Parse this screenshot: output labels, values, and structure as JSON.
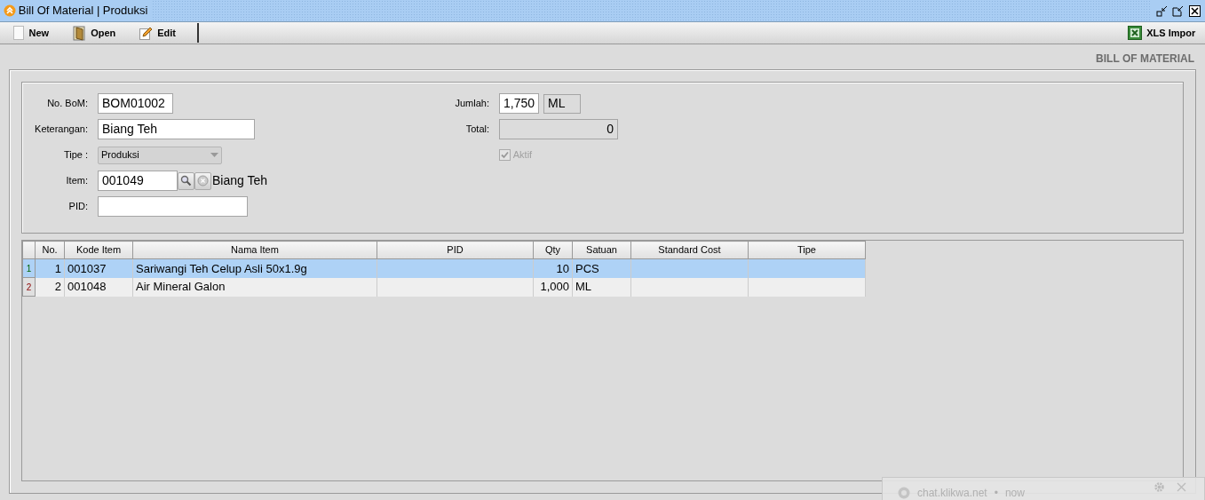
{
  "window": {
    "title": "Bill Of Material | Produksi"
  },
  "toolbar": {
    "buttons": [
      {
        "label": "New",
        "kind": "new"
      },
      {
        "label": "Open",
        "kind": "open"
      },
      {
        "label": "Edit",
        "kind": "edit"
      }
    ],
    "import_button": {
      "label": "XLS Impor"
    }
  },
  "page_title": "BILL OF MATERIAL",
  "form": {
    "no_bom": {
      "label": "No. BoM:",
      "value": "BOM01002"
    },
    "keterangan": {
      "label": "Keterangan:",
      "value": "Biang Teh"
    },
    "tipe": {
      "label": "Tipe :",
      "value": "Produksi",
      "disabled": true
    },
    "item": {
      "label": "Item:",
      "value": "001049",
      "name": "Biang Teh"
    },
    "pid": {
      "label": "PID:"
    },
    "jumlah": {
      "label": "Jumlah:",
      "value": "1,750",
      "unit": "ML"
    },
    "total": {
      "label": "Total:",
      "value": "0"
    },
    "aktif": {
      "label": "Aktif",
      "checked": true,
      "disabled": true
    }
  },
  "table": {
    "columns": [
      "No.",
      "Kode Item",
      "Nama Item",
      "PID",
      "Qty",
      "Satuan",
      "Standard Cost",
      "Tipe"
    ],
    "rows": [
      {
        "row_header": "1",
        "selected": true,
        "cells": [
          "1",
          "001037",
          "Sariwangi Teh Celup Asli 50x1.9g",
          "",
          "10",
          "PCS",
          "",
          ""
        ]
      },
      {
        "row_header": "2",
        "selected": false,
        "cells": [
          "2",
          "001048",
          "Air Mineral Galon",
          "",
          "1,000",
          "ML",
          "",
          ""
        ]
      }
    ]
  },
  "notification": {
    "source": "chat.klikwa.net",
    "separator": "•",
    "time": "now"
  }
}
